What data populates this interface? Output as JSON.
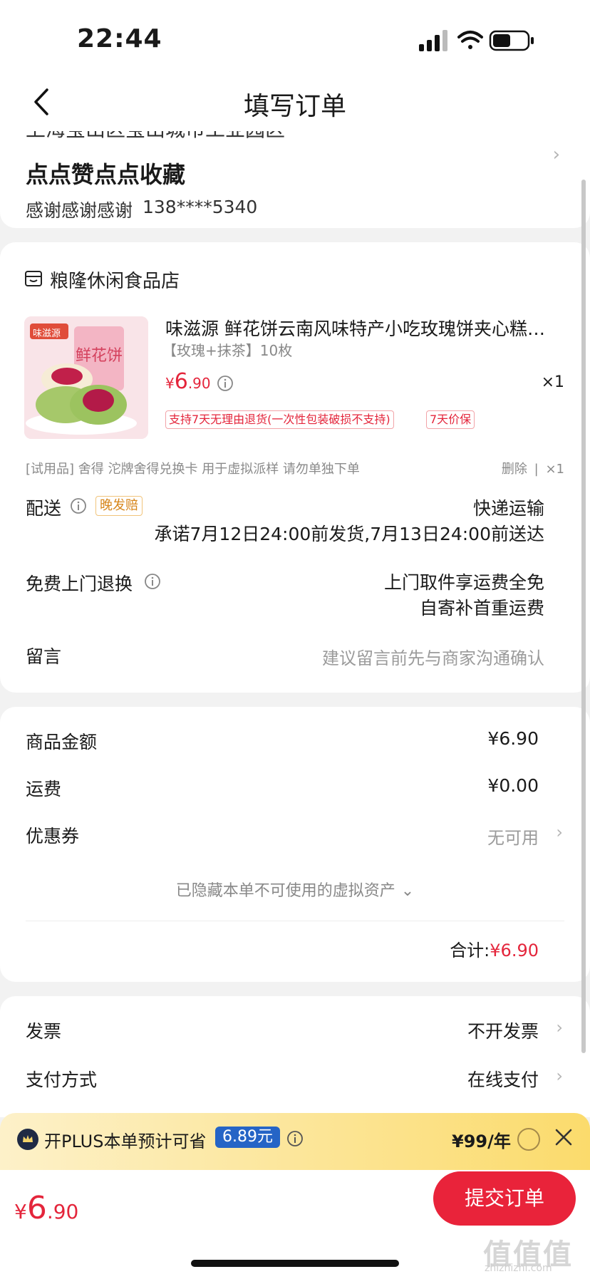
{
  "status_bar": {
    "time": "22:44"
  },
  "header": {
    "title": "填写订单"
  },
  "address": {
    "cut_line": "上海宝山区宝山城市工业园区",
    "name": "点点赞点点收藏",
    "contact": "感谢感谢感谢",
    "phone": "138****5340"
  },
  "store": {
    "name": "粮隆休闲食品店",
    "product": {
      "title": "味滋源 鲜花饼云南风味特产小吃玫瑰饼夹心糕点零食",
      "variant": "【玫瑰+抹茶】10枚",
      "price_symbol": "¥",
      "price_int": "6",
      "price_dec": ".90",
      "qty": "×1",
      "tags": [
        "支持7天无理由退货(一次性包装破损不支持)",
        "7天价保"
      ],
      "thumb_brand": "味滋源",
      "thumb_text": "鲜花饼"
    },
    "gift": {
      "text": "[试用品] 舍得 沱牌舍得兑换卡 用于虚拟派样 请勿单独下单",
      "delete": "删除",
      "separator": "|",
      "qty": "×1"
    },
    "delivery": {
      "label": "配送",
      "badge": "晚发赔",
      "method": "快递运输",
      "promise": "承诺7月12日24:00前发货,7月13日24:00前送达"
    },
    "return": {
      "label": "免费上门退换",
      "line1": "上门取件享运费全免",
      "line2": "自寄补首重运费"
    },
    "message": {
      "label": "留言",
      "placeholder": "建议留言前先与商家沟通确认"
    }
  },
  "costs": {
    "goods_label": "商品金额",
    "goods_value": "¥6.90",
    "shipping_label": "运费",
    "shipping_value": "¥0.00",
    "coupon_label": "优惠券",
    "coupon_value": "无可用",
    "hidden_assets": "已隐藏本单不可使用的虚拟资产",
    "total_label": "合计:",
    "total_value": "¥6.90"
  },
  "invoice": {
    "label": "发票",
    "value": "不开发票",
    "pay_label": "支付方式",
    "pay_value": "在线支付"
  },
  "plus": {
    "text": "开PLUS本单预计可省",
    "amount": "6.89元",
    "price": "¥99/年"
  },
  "bottom": {
    "price_symbol": "¥",
    "price_int": "6",
    "price_dec": ".90",
    "submit": "提交订单"
  },
  "watermark": {
    "text": "值值值",
    "sub": "zhizhizhi.com"
  },
  "colors": {
    "accent": "#e4253b",
    "submit": "#e9233a",
    "plus_blue": "#2564c6",
    "late_badge": "#d7861b"
  }
}
